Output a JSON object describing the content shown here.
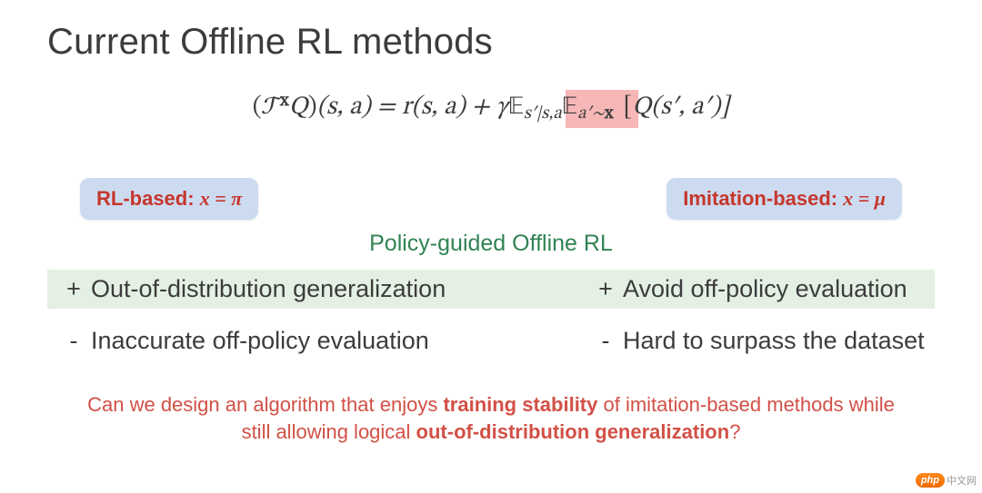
{
  "title": "Current Offline RL methods",
  "equation": {
    "left_paren": "(",
    "op": "𝒯",
    "sup": "x",
    "q1": "Q",
    "right_paren": ")",
    "args1": "(s, a) = r(s, a) + γ",
    "E1": "𝔼",
    "sub1": "s′|s,a",
    "E2": "𝔼",
    "sub2_a": "a′∼",
    "sub2_b": "x",
    "bracket_open": " [",
    "q2": "Q",
    "args2": "(s′, a′)]"
  },
  "pill_left": {
    "label": "RL-based: ",
    "var": "x = π"
  },
  "pill_right": {
    "label": "Imitation-based: ",
    "var": "x = μ"
  },
  "subtitle": "Policy-guided Offline RL",
  "list": {
    "plus": {
      "sym": "+",
      "left": "Out-of-distribution generalization",
      "right": "Avoid off-policy evaluation"
    },
    "minus": {
      "sym": "-",
      "left": "Inaccurate off-policy evaluation",
      "right": "Hard to surpass the dataset"
    }
  },
  "question": {
    "pre": "Can we design an algorithm that enjoys ",
    "b1": "training stability",
    "mid": " of imitation-based methods while still allowing logical ",
    "b2": "out-of-distribution generalization",
    "post": "?"
  },
  "watermark": {
    "logo": "php",
    "text": "中文网"
  }
}
